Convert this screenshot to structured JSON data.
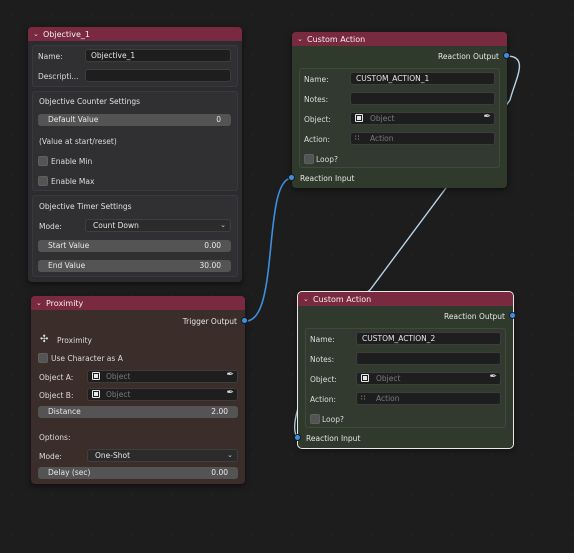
{
  "colors": {
    "header": "#7a2a40",
    "objective_body": "#2c2c30",
    "proximity_body": "#3a2d2a",
    "action_body": "#2f3a2c",
    "socket": "#3d8fe0",
    "wire_blue": "#3d8fe0",
    "wire_white": "#b8d4ea"
  },
  "objective": {
    "title": "Objective_1",
    "name_label": "Name:",
    "name_value": "Objective_1",
    "desc_label": "Descripti...",
    "desc_value": "",
    "counter_title": "Objective Counter Settings",
    "default_label": "Default Value",
    "default_value": "0",
    "value_note": "(Value at start/reset)",
    "enable_min": "Enable Min",
    "enable_max": "Enable Max",
    "timer_title": "Objective Timer Settings",
    "mode_label": "Mode:",
    "mode_value": "Count Down",
    "start_label": "Start Value",
    "start_value": "0.00",
    "end_label": "End Value",
    "end_value": "30.00"
  },
  "proximity": {
    "title": "Proximity",
    "output": "Trigger Output",
    "icon_label": "Proximity",
    "use_char": "Use Character as A",
    "obj_a_label": "Object A:",
    "obj_b_label": "Object B:",
    "object_placeholder": "Object",
    "distance_label": "Distance",
    "distance_value": "2.00",
    "options_label": "Options:",
    "mode_label": "Mode:",
    "mode_value": "One-Shot",
    "delay_label": "Delay (sec)",
    "delay_value": "0.00"
  },
  "action1": {
    "title": "Custom Action",
    "output": "Reaction Output",
    "name_label": "Name:",
    "name_value": "CUSTOM_ACTION_1",
    "notes_label": "Notes:",
    "notes_value": "",
    "object_label": "Object:",
    "object_placeholder": "Object",
    "action_label": "Action:",
    "action_placeholder": "Action",
    "loop_label": "Loop?",
    "input": "Reaction Input"
  },
  "action2": {
    "title": "Custom Action",
    "output": "Reaction Output",
    "name_label": "Name:",
    "name_value": "CUSTOM_ACTION_2",
    "notes_label": "Notes:",
    "notes_value": "",
    "object_label": "Object:",
    "object_placeholder": "Object",
    "action_label": "Action:",
    "action_placeholder": "Action",
    "loop_label": "Loop?",
    "input": "Reaction Input"
  }
}
